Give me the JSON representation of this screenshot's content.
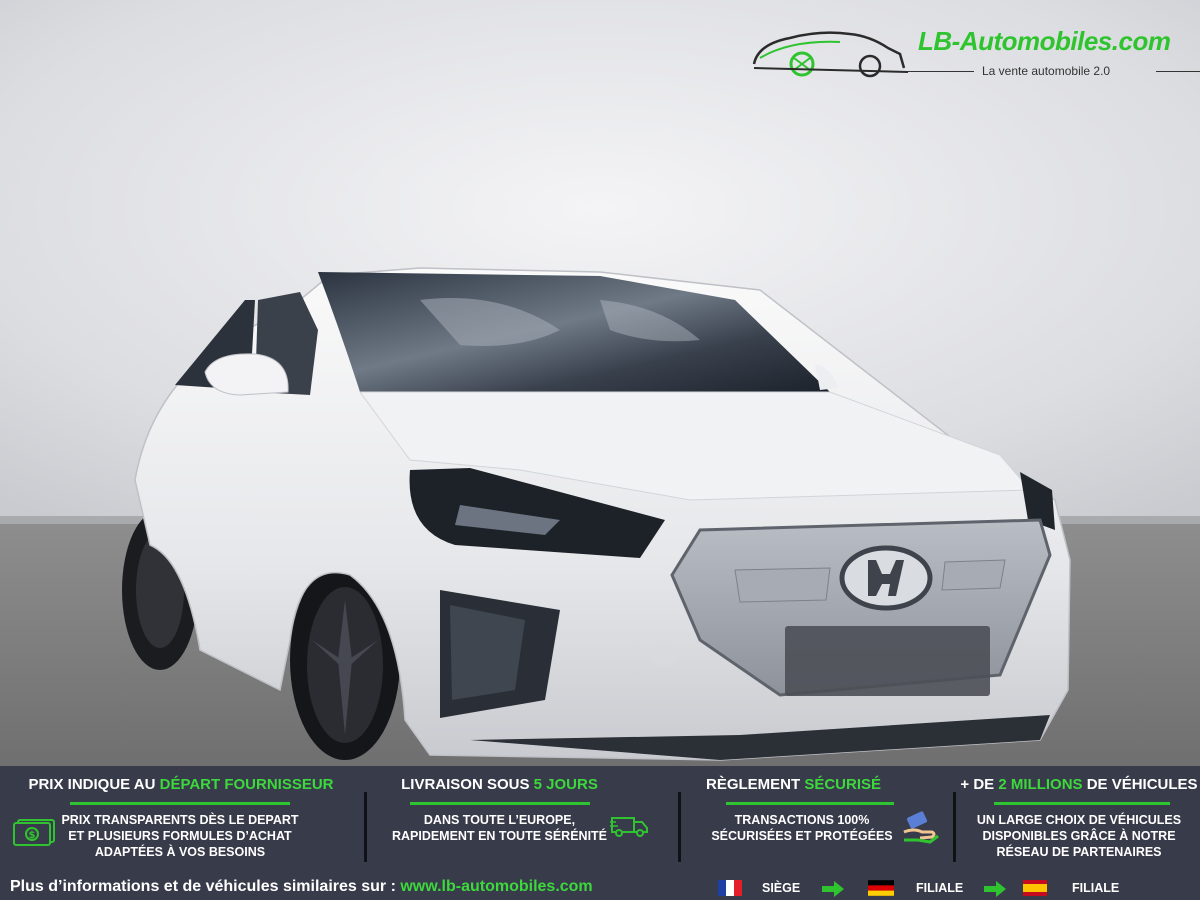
{
  "logo": {
    "brand": "LB-Automobiles.com",
    "tagline": "La vente automobile 2.0"
  },
  "photo": {
    "subject": "white Hyundai Ioniq electric hatchback, front three-quarter view",
    "badge": "hyundai-logo"
  },
  "colors": {
    "accent": "#2fc42f",
    "banner_bg": "#383c4a",
    "text": "#ffffff"
  },
  "banner": {
    "items": [
      {
        "title_pre": "PRIX INDIQUE AU ",
        "title_hl": "DÉPART FOURNISSEUR",
        "title_post": "",
        "line1": "PRIX TRANSPARENTS DÈS LE DEPART",
        "line2": "ET PLUSIEURS FORMULES D’ACHAT",
        "line3": "ADAPTÉES À VOS BESOINS",
        "icon": "money-icon"
      },
      {
        "title_pre": "LIVRAISON SOUS ",
        "title_hl": "5 JOURS",
        "title_post": "",
        "line1": "DANS TOUTE L’EUROPE,",
        "line2": "RAPIDEMENT EN TOUTE SÉRÉNITÉ",
        "line3": "",
        "icon": "delivery-truck-icon"
      },
      {
        "title_pre": "RÈGLEMENT ",
        "title_hl": "SÉCURISÉ",
        "title_post": "",
        "line1": "TRANSACTIONS 100%",
        "line2": "SÉCURISÉES ET PROTÉGÉES",
        "line3": "",
        "icon": "payment-hand-icon"
      },
      {
        "title_pre": "+ DE ",
        "title_hl": "2 MILLIONS",
        "title_post": " DE VÉHICULES",
        "line1": "UN LARGE CHOIX DE VÉHICULES",
        "line2": "DISPONIBLES GRÂCE À NOTRE",
        "line3": "RÉSEAU DE PARTENAIRES",
        "icon": ""
      }
    ]
  },
  "footer": {
    "info_prefix": "Plus d’informations et de véhicules similaires sur : ",
    "url": "www.lb-automobiles.com",
    "locations": [
      {
        "flag": "france-flag-icon",
        "label": "SIÈGE"
      },
      {
        "flag": "germany-flag-icon",
        "label": "FILIALE"
      },
      {
        "flag": "spain-flag-icon",
        "label": "FILIALE"
      }
    ]
  }
}
